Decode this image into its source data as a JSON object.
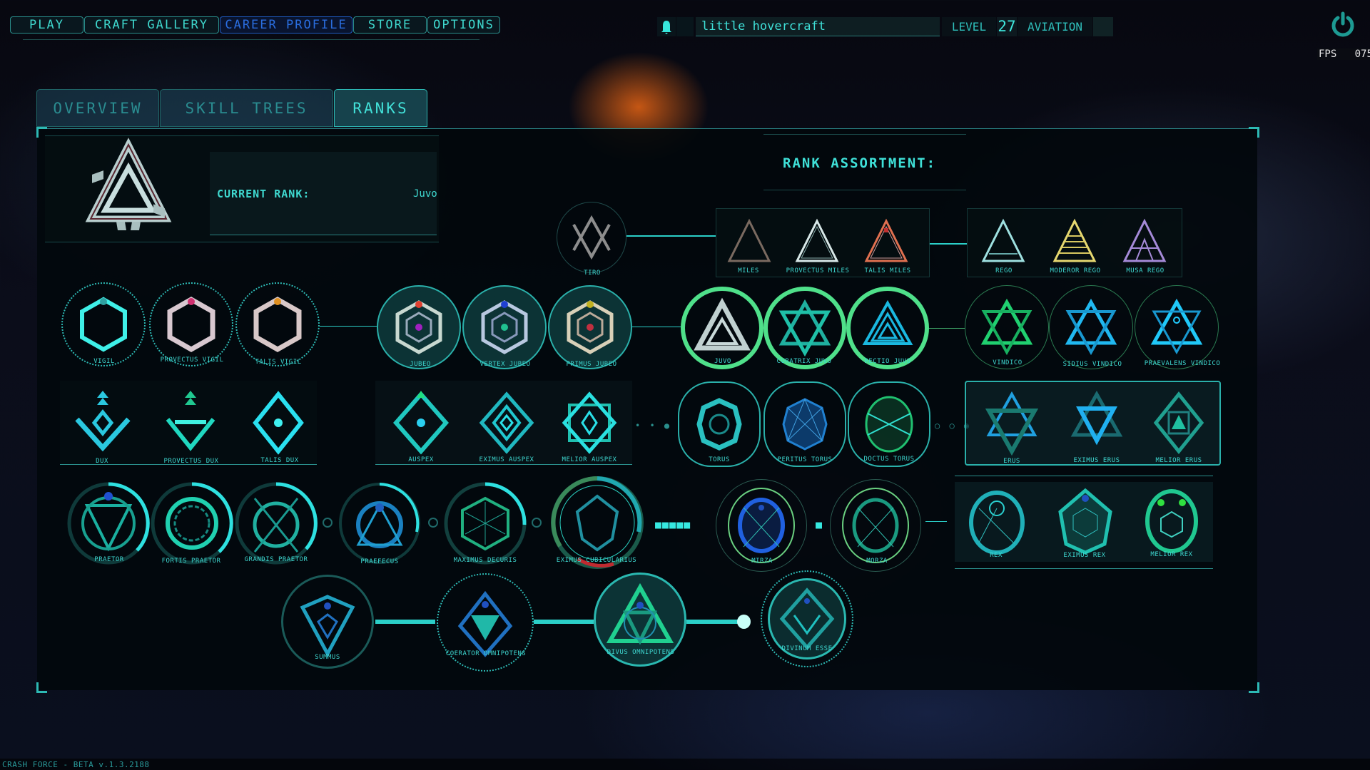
{
  "nav": {
    "items": [
      {
        "label": "PLAY",
        "active": false
      },
      {
        "label": "CRAFT GALLERY",
        "active": false
      },
      {
        "label": "CAREER PROFILE",
        "active": true
      },
      {
        "label": "STORE",
        "active": false
      },
      {
        "label": "OPTIONS",
        "active": false
      }
    ]
  },
  "header": {
    "notification_icon": "bell-icon",
    "player_name": "little hovercraft",
    "level_label": "LEVEL",
    "level_value": "27",
    "class_label": "AVIATION",
    "power_icon": "power-icon",
    "fps_label": "FPS",
    "fps_value": "075"
  },
  "tabs": [
    {
      "label": "OVERVIEW",
      "active": false
    },
    {
      "label": "SKILL TREES",
      "active": false
    },
    {
      "label": "RANKS",
      "active": true
    }
  ],
  "current_rank": {
    "label": "CURRENT RANK:",
    "value": "Juvo"
  },
  "assortment": {
    "title": "RANK ASSORTMENT:"
  },
  "ranks": {
    "tiro": "TIRO",
    "miles": [
      "MILES",
      "PROVECTUS MILES",
      "TALIS MILES"
    ],
    "rego": [
      "REGO",
      "MODEROR REGO",
      "MUSA REGO"
    ],
    "vigil": [
      "VIGIL",
      "PROVECTUS VIGIL",
      "TALIS VIGIL"
    ],
    "jubeo": [
      "JUBEO",
      "VERTEX JUBEO",
      "PRIMUS JUBEO"
    ],
    "juvo": [
      "JUVO",
      "CURATRIX JUVO",
      "RECTIO JUVO"
    ],
    "vindico": [
      "VINDICO",
      "SIDIUS VINDICO",
      "PRAEVALENS VINDICO"
    ],
    "dux": [
      "DUX",
      "PROVECTUS DUX",
      "TALIS DUX"
    ],
    "auspex": [
      "AUSPEX",
      "EXIMUS AUSPEX",
      "MELIOR AUSPEX"
    ],
    "torus": [
      "TORUS",
      "PERITUS TORUS",
      "DOCTUS TORUS"
    ],
    "erus": [
      "ERUS",
      "EXIMUS ERUS",
      "MELIOR ERUS"
    ],
    "praetor": [
      "PRAETOR",
      "FORTIS PRAETOR",
      "GRANDIS PRAETOR"
    ],
    "praefecus": "PRAEFECUS",
    "maximus_decuris": "MAXIMUS DECURIS",
    "eximus_cubicularius": "EXIMUS CUBICULARIUS",
    "mirza": "MIRZA",
    "morza": "MORZA",
    "rex": [
      "REX",
      "EXIMUS REX",
      "MELIOR REX"
    ],
    "summus": "SUMMUS",
    "coerator": "COERATOR OMNIPOTENS",
    "divus": "DIVUS OMNIPOTENS",
    "divinum": "DIVINUM ESSE"
  },
  "footer": {
    "version": "CRASH FORCE - BETA v.1.3.2188"
  },
  "colors": {
    "accent": "#2fd6d0",
    "active_nav": "#2a6ee0",
    "current_rank_ring": "#4fe08a"
  }
}
